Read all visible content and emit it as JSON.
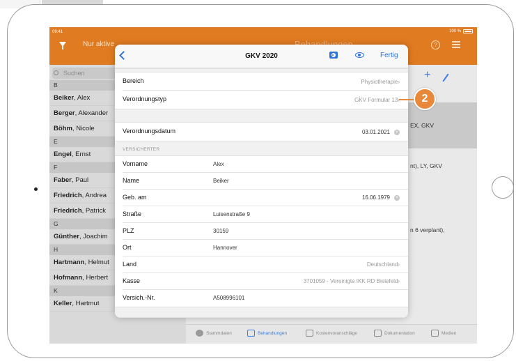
{
  "status": {
    "time": "09:41",
    "battery": "100 %"
  },
  "nav": {
    "filter_label": "Nur aktive",
    "title": "Behandlungen"
  },
  "sidebar": {
    "search_placeholder": "Suchen",
    "rows": [
      {
        "type": "letter",
        "text": "B"
      },
      {
        "type": "name",
        "last": "Beiker",
        "first": ", Alex"
      },
      {
        "type": "name",
        "last": "Berger",
        "first": ", Alexander"
      },
      {
        "type": "name",
        "last": "Böhm",
        "first": ", Nicole"
      },
      {
        "type": "letter",
        "text": "E"
      },
      {
        "type": "name",
        "last": "Engel",
        "first": ", Ernst"
      },
      {
        "type": "letter",
        "text": "F"
      },
      {
        "type": "name",
        "last": "Faber",
        "first": ", Paul"
      },
      {
        "type": "name",
        "last": "Friedrich",
        "first": ", Andrea"
      },
      {
        "type": "name",
        "last": "Friedrich",
        "first": ", Patrick"
      },
      {
        "type": "letter",
        "text": "G"
      },
      {
        "type": "name",
        "last": "Günther",
        "first": ", Joachim"
      },
      {
        "type": "letter",
        "text": "H"
      },
      {
        "type": "name",
        "last": "Hartmann",
        "first": ", Helmut"
      },
      {
        "type": "name",
        "last": "Hofmann",
        "first": ", Herbert"
      },
      {
        "type": "letter",
        "text": "K"
      },
      {
        "type": "name",
        "last": "Keller",
        "first": ", Hartmut"
      }
    ]
  },
  "detail": {
    "snippet1": "EX, GKV",
    "snippet2": "nt), LY, GKV",
    "snippet3": "n 6 verplant),"
  },
  "tabs": {
    "stammdaten": "Stammdaten",
    "behandlungen": "Behandlungen",
    "kostenvoranschlaege": "Kostenvoranschläge",
    "dokumentation": "Dokumentation",
    "medien": "Medien"
  },
  "modal": {
    "title": "GKV 2020",
    "done_label": "Fertig",
    "bereich_label": "Bereich",
    "bereich_value": "Physiotherapie",
    "verordnungstyp_label": "Verordnungstyp",
    "verordnungstyp_value": "GKV Formular 13",
    "verordnungsdatum_label": "Verordnungsdatum",
    "verordnungsdatum_value": "03.01.2021",
    "section_versicherter": "VERSICHERTER",
    "vorname_label": "Vorname",
    "vorname_value": "Alex",
    "name_label": "Name",
    "name_value": "Beiker",
    "geb_label": "Geb. am",
    "geb_value": "16.06.1979",
    "strasse_label": "Straße",
    "strasse_value": "Luisenstraße 9",
    "plz_label": "PLZ",
    "plz_value": "30159",
    "ort_label": "Ort",
    "ort_value": "Hannover",
    "land_label": "Land",
    "land_value": "Deutschland",
    "kasse_label": "Kasse",
    "kasse_value": "3701059  - Vereinigte IKK RD Bielefeld",
    "versnr_label": "Versich.-Nr.",
    "versnr_value": "A508996101"
  },
  "callout": {
    "number": "2"
  },
  "colors": {
    "brand_orange": "#e17b21",
    "accent_blue": "#2f74d6",
    "callout_orange": "#e8883a"
  }
}
